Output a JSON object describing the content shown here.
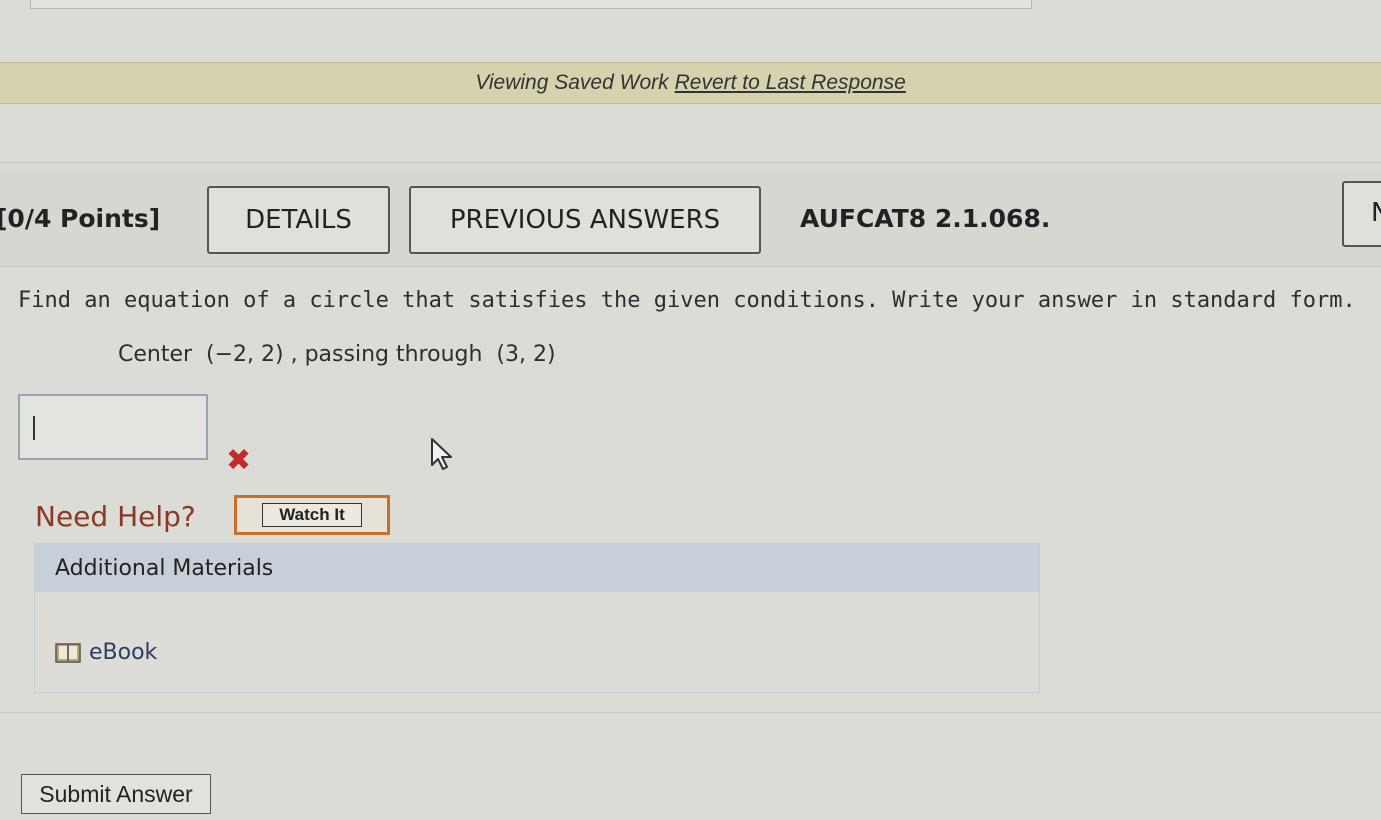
{
  "saved_bar": {
    "message": "Viewing Saved Work",
    "revert_link": "Revert to Last Response"
  },
  "question": {
    "points": "[0/4 Points]",
    "details_label": "DETAILS",
    "previous_answers_label": "PREVIOUS ANSWERS",
    "code": "AUFCAT8 2.1.068.",
    "partial_button_label": "N",
    "prompt": "Find an equation of a circle that satisfies the given conditions. Write your answer in standard form.",
    "given": "Center  (−2, 2) , passing through  (3, 2)",
    "answer_value": "",
    "status": "incorrect"
  },
  "help": {
    "need_help_label": "Need Help?",
    "watch_label": "Watch It"
  },
  "materials": {
    "title": "Additional Materials",
    "ebook_label": "eBook"
  },
  "submit_label": "Submit Answer",
  "colors": {
    "saved_bar_bg": "#d5d2ad",
    "wrong_mark": "#c42a2a",
    "need_help_text": "#8a3a24",
    "watch_border": "#c96f2a",
    "materials_head_bg": "#c7d0d8"
  },
  "icons": {
    "wrong": "close-x-icon",
    "ebook": "book-icon",
    "cursor": "mouse-pointer-icon"
  }
}
